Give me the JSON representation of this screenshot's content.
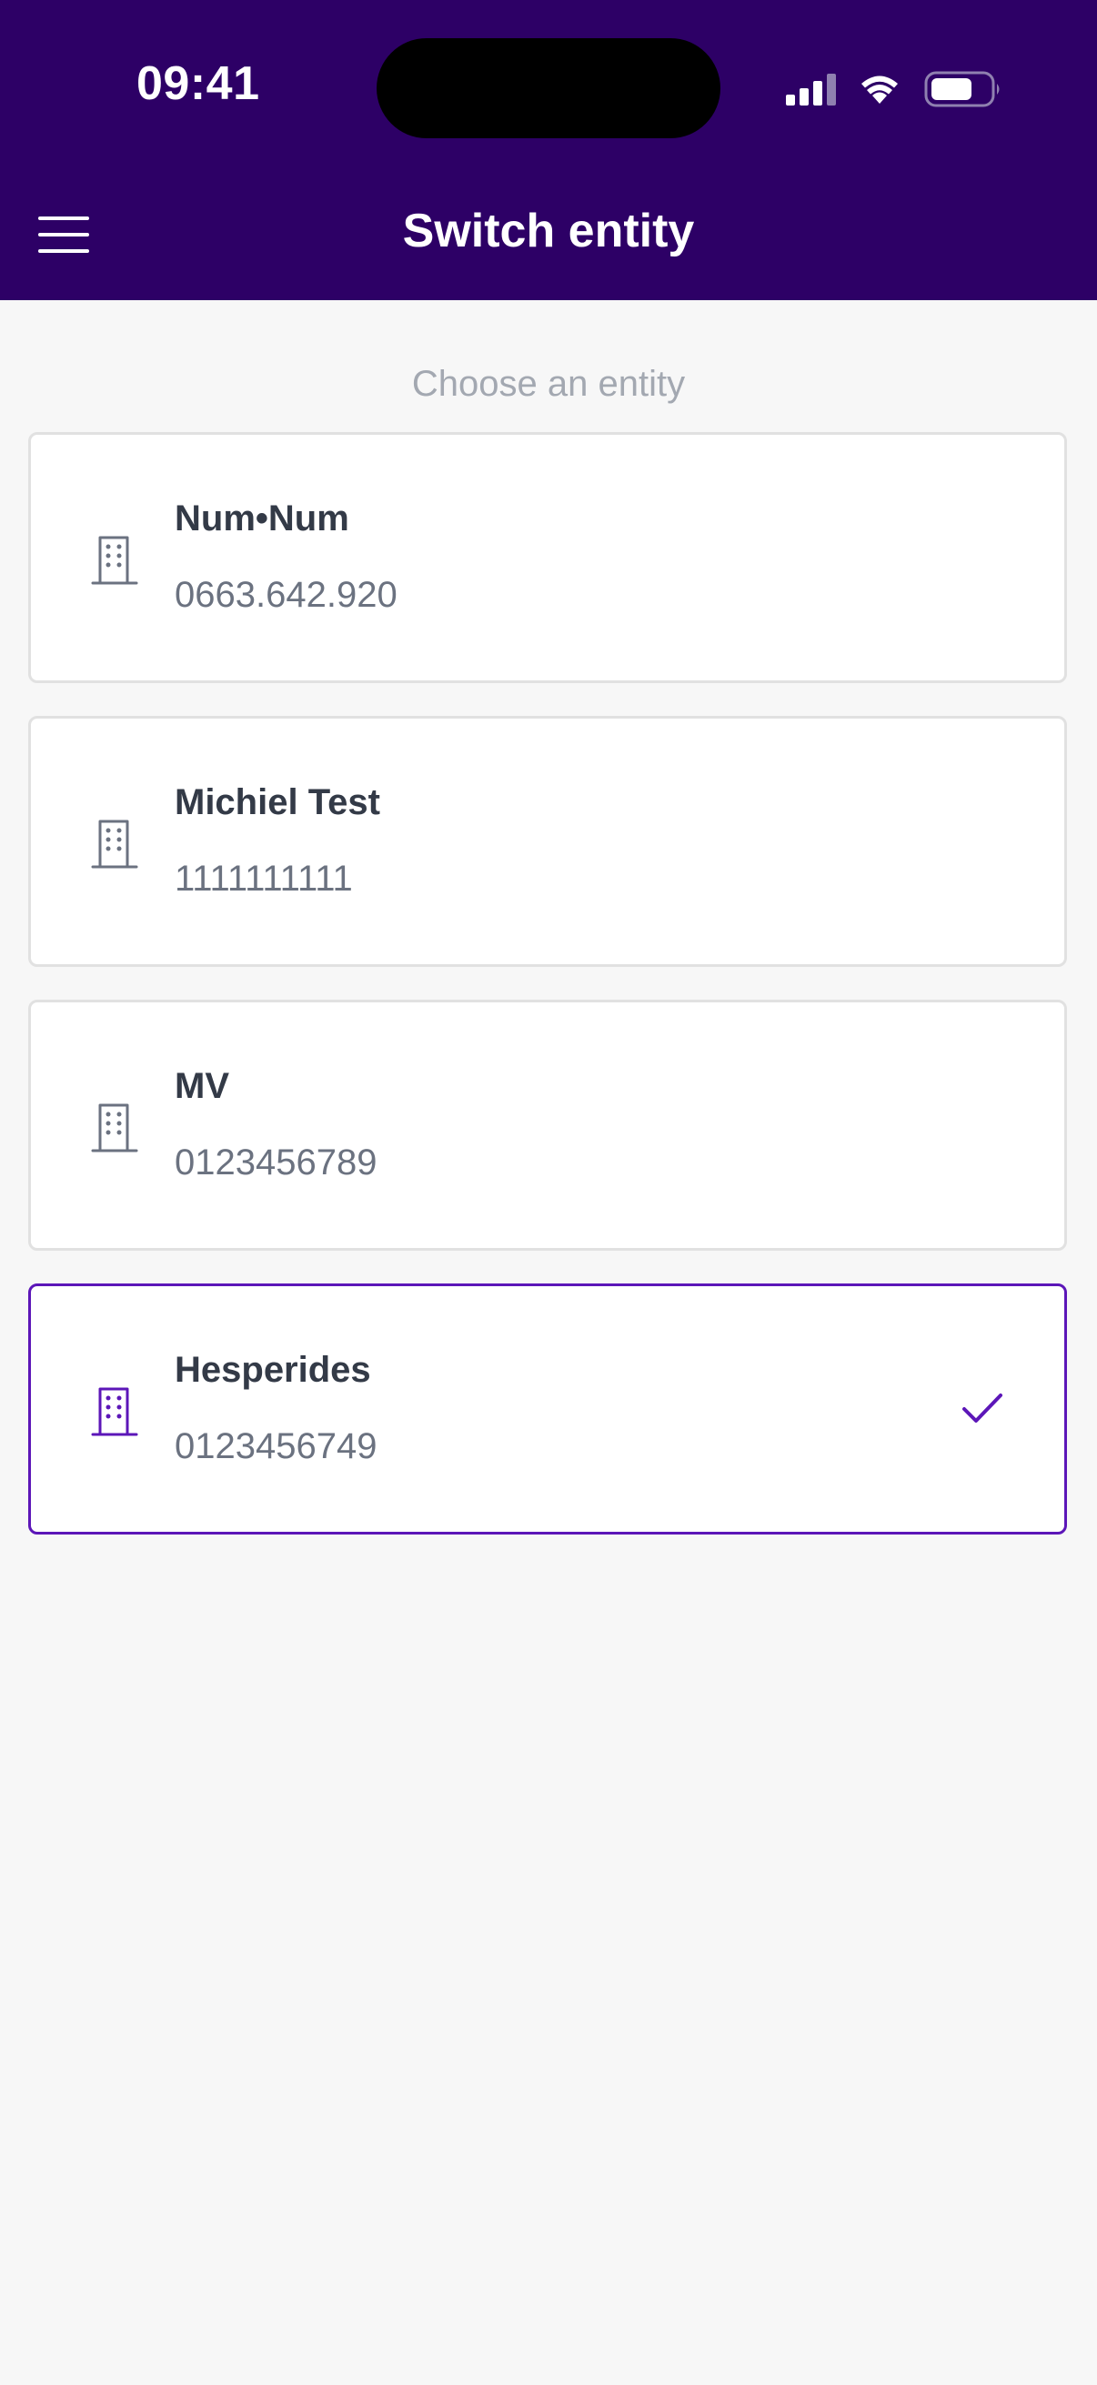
{
  "status_bar": {
    "time": "09:41"
  },
  "header": {
    "title": "Switch entity"
  },
  "section": {
    "label": "Choose an entity"
  },
  "entities": [
    {
      "name": "Num•Num",
      "number": "0663.642.920",
      "selected": false
    },
    {
      "name": "Michiel Test",
      "number": "1111111111",
      "selected": false
    },
    {
      "name": "MV",
      "number": "0123456789",
      "selected": false
    },
    {
      "name": "Hesperides",
      "number": "0123456749",
      "selected": true
    }
  ],
  "colors": {
    "header_bg": "#2d0066",
    "accent": "#5c16b8",
    "icon_default": "#6b7280"
  },
  "icons": {
    "menu": "hamburger-menu-icon",
    "entity": "building-icon",
    "selected": "checkmark-icon"
  }
}
